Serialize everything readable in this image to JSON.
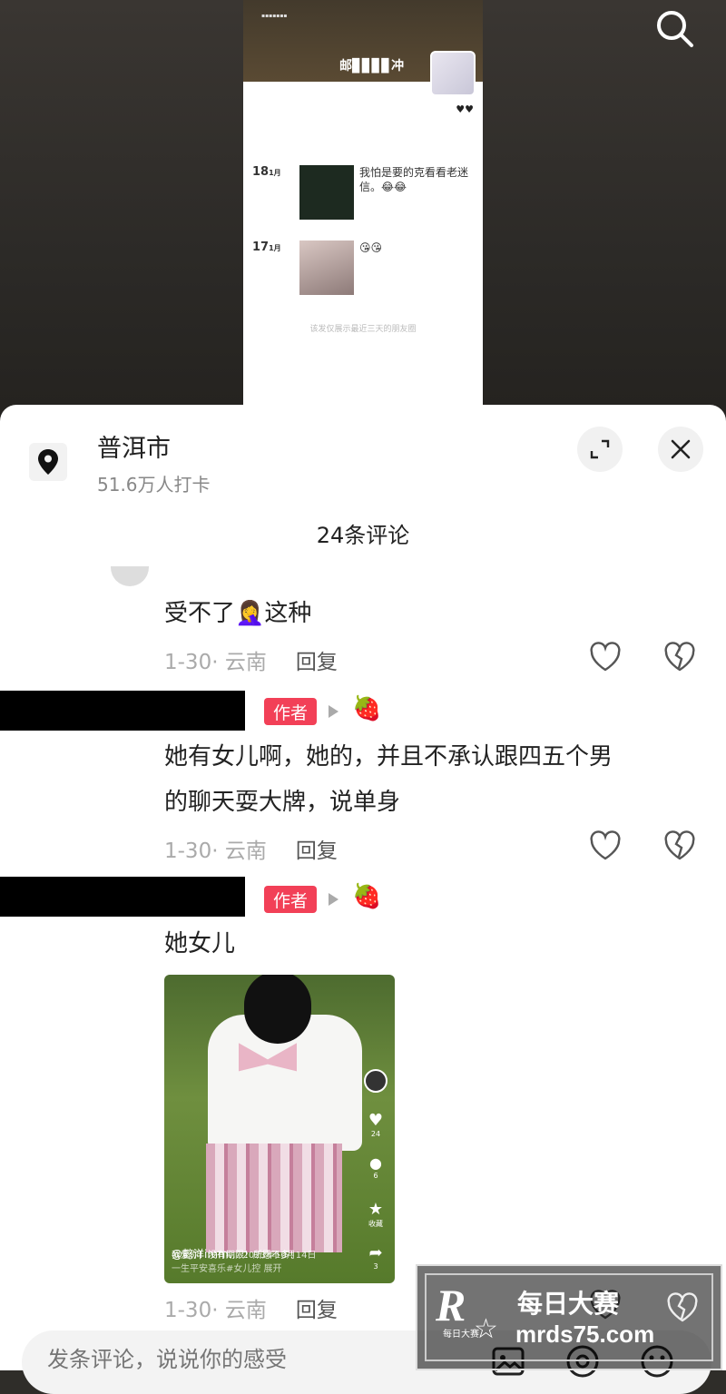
{
  "background_post": {
    "title_blurred": "邮▊▊▊▊冲",
    "hearts": "♥♥",
    "posts": [
      {
        "day": "18",
        "month": "1月",
        "text": "我怕是要的克看看老迷信。😂😂"
      },
      {
        "day": "17",
        "month": "1月",
        "text": "😘😘"
      }
    ],
    "footer": "该发仅展示最近三天的朋友圈"
  },
  "sheet": {
    "city": "普洱市",
    "checkin_count": "51.6万人打卡",
    "comment_count": "24条评论"
  },
  "comments": [
    {
      "text": "受不了🤦‍♀️这种",
      "date": "1-30· 云南",
      "reply": "回复"
    },
    {
      "author_badge": "作者",
      "text_line1": "她有女儿啊，她的，并且不承认跟四五个男",
      "text_line2": "的聊天耍大牌，说单身",
      "date": "1-30· 云南",
      "reply": "回复"
    },
    {
      "author_badge": "作者",
      "text": "她女儿",
      "date": "1-30· 云南",
      "reply": "回复",
      "video": {
        "handle": "@懿洋imm…",
        "date": "2023年10月14日",
        "caption": "我爱你！没有期限！所愿不多！",
        "caption2": "一生平安喜乐#女儿控 展开",
        "likes": "24",
        "comments": "6",
        "favorite_label": "收藏",
        "shares": "3"
      }
    }
  ],
  "input": {
    "placeholder": "发条评论，说说你的感受"
  },
  "watermark": {
    "logo": "R",
    "title": "每日大赛",
    "url": "mrds75.com",
    "small": "每日大赛"
  },
  "colors": {
    "author_badge": "#f24057",
    "sheet_bg": "#ffffff",
    "dim_bg": "#2f2d29"
  }
}
